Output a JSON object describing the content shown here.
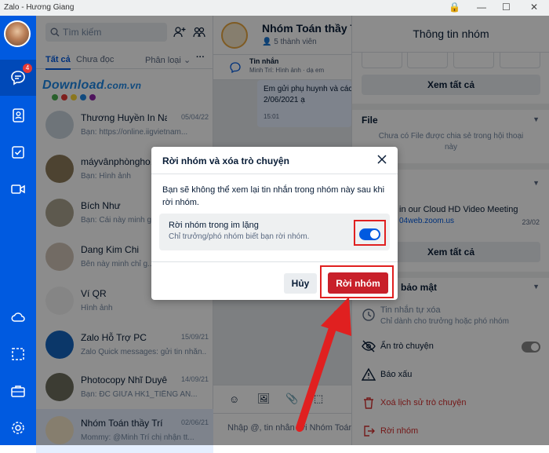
{
  "titlebar": {
    "title": "Zalo - Hương Giang"
  },
  "rail": {
    "message_badge": "4"
  },
  "sidebar": {
    "search_placeholder": "Tìm kiếm",
    "tab_all": "Tất cả",
    "tab_unread": "Chưa đọc",
    "classify": "Phân loại",
    "more": "···",
    "watermark": "Download",
    "watermark_suffix": ".com.vn",
    "conversations": [
      {
        "name": "Thương Huyền In Na...",
        "time": "05/04/22",
        "preview": "Bạn: https://online.iigvietnam..."
      },
      {
        "name": "máyvânphòngho...",
        "time": "",
        "preview": "Bạn: Hình ảnh"
      },
      {
        "name": "Bích Như",
        "time": "",
        "preview": "Bạn: Cái này minh g..."
      },
      {
        "name": "Dang Kim Chi",
        "time": "",
        "preview": "Bên này minh chỉ g..."
      },
      {
        "name": "Ví QR",
        "time": "",
        "preview": "Hình ảnh"
      },
      {
        "name": "Zalo Hỗ Trợ PC",
        "time": "15/09/21",
        "preview": "Zalo Quick messages: gửi tin nhắn..."
      },
      {
        "name": "Photocopy Nhĩ Duyên",
        "time": "14/09/21",
        "preview": "Bạn: ĐC GIỮA HK1_TIẾNG AN..."
      },
      {
        "name": "Nhóm Toán thầy Trí",
        "time": "02/06/21",
        "preview": "Mommy: @Minh Trí chị nhận tt..."
      }
    ]
  },
  "chat": {
    "group_name": "Nhóm Toán thầy Trí",
    "members": "5 thành viên",
    "pinned_title": "Tin nhắn",
    "pinned_detail": "Minh Trí: Hình ảnh · dạ em",
    "bubble_lines": [
      "Em gửi phụ huynh và các",
      "2/06/2021 ạ",
      "15:01"
    ],
    "input_placeholder": "Nhập @, tin nhắn tới Nhóm Toán"
  },
  "info": {
    "title": "Thông tin nhóm",
    "see_all": "Xem tất cả",
    "file_header": "File",
    "file_empty": "Chưa có File được chia sẻ trong hội thoại này",
    "link_title": "in our Cloud HD Video Meeting",
    "link_url": "04web.zoom.us",
    "link_date": "23/02",
    "see_all_2": "Xem tất cả",
    "security_header": "bảo mật",
    "auto_delete": "Tin nhắn tự xóa",
    "auto_delete_sub": "Chỉ dành cho trưởng hoặc phó nhóm",
    "hide_chat": "Ẩn trò chuyện",
    "report": "Báo xấu",
    "delete_history": "Xoá lịch sử trò chuyện",
    "leave_group": "Rời nhóm"
  },
  "dialog": {
    "title": "Rời nhóm và xóa trò chuyện",
    "body": "Bạn sẽ không thể xem lại tin nhắn trong nhóm này sau khi rời nhóm.",
    "option_title": "Rời nhóm trong im lặng",
    "option_sub": "Chỉ trưởng/phó nhóm biết bạn rời nhóm.",
    "silent_toggle_on": true,
    "cancel": "Hủy",
    "confirm": "Rời nhóm"
  },
  "colors": {
    "brand": "#005ae0",
    "danger": "#c8202a",
    "highlight": "#e02020"
  }
}
